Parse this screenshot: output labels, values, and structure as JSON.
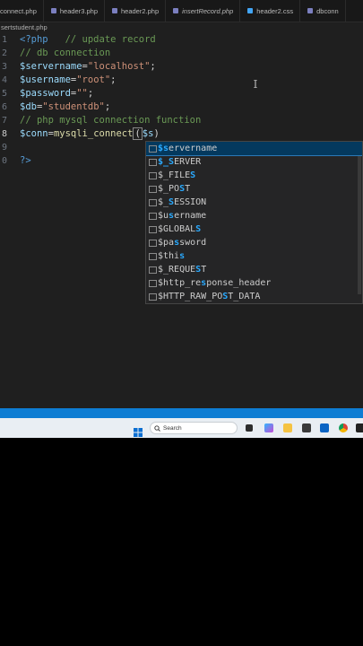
{
  "tabs": [
    {
      "label": "connect.php",
      "color": "#7b7fbf",
      "italic": false
    },
    {
      "label": "header3.php",
      "color": "#7b7fbf",
      "italic": false
    },
    {
      "label": "header2.php",
      "color": "#7b7fbf",
      "italic": false
    },
    {
      "label": "insertRecord.php",
      "color": "#7b7fbf",
      "italic": true
    },
    {
      "label": "header2.css",
      "color": "#42a5f5",
      "italic": false
    },
    {
      "label": "dbconn",
      "color": "#7b7fbf",
      "italic": false
    }
  ],
  "breadcrumb": "sertstudent.php",
  "lines": [
    {
      "n": "1",
      "parts": [
        {
          "t": "<?php",
          "c": "c-tag"
        },
        {
          "t": "   // update record",
          "c": "c-com"
        }
      ]
    },
    {
      "n": "2",
      "parts": [
        {
          "t": "// db connection",
          "c": "c-com"
        }
      ]
    },
    {
      "n": "3",
      "parts": [
        {
          "t": "$servername",
          "c": "c-var"
        },
        {
          "t": "=",
          "c": "c-pun"
        },
        {
          "t": "\"localhost\"",
          "c": "c-str"
        },
        {
          "t": ";",
          "c": "c-pun"
        }
      ]
    },
    {
      "n": "4",
      "parts": [
        {
          "t": "$username",
          "c": "c-var"
        },
        {
          "t": "=",
          "c": "c-pun"
        },
        {
          "t": "\"root\"",
          "c": "c-str"
        },
        {
          "t": ";",
          "c": "c-pun"
        }
      ]
    },
    {
      "n": "5",
      "parts": [
        {
          "t": "$password",
          "c": "c-var"
        },
        {
          "t": "=",
          "c": "c-pun"
        },
        {
          "t": "\"\"",
          "c": "c-str"
        },
        {
          "t": ";",
          "c": "c-pun"
        }
      ]
    },
    {
      "n": "6",
      "parts": [
        {
          "t": "$db",
          "c": "c-var"
        },
        {
          "t": "=",
          "c": "c-pun"
        },
        {
          "t": "\"studentdb\"",
          "c": "c-str"
        },
        {
          "t": ";",
          "c": "c-pun"
        }
      ]
    },
    {
      "n": "7",
      "parts": [
        {
          "t": "// php mysql connection function",
          "c": "c-com"
        }
      ]
    },
    {
      "n": "8",
      "parts": [
        {
          "t": "$conn",
          "c": "c-var"
        },
        {
          "t": "=",
          "c": "c-pun"
        },
        {
          "t": "mysqli_connect",
          "c": "c-fn"
        },
        {
          "t": "(",
          "c": "c-pun cursor-box"
        },
        {
          "t": "$s",
          "c": "c-var"
        },
        {
          "t": ")",
          "c": "c-pun"
        }
      ],
      "active": true
    },
    {
      "n": "9",
      "parts": []
    },
    {
      "n": "0",
      "parts": [
        {
          "t": "?>",
          "c": "c-tag"
        }
      ]
    }
  ],
  "suggestions": [
    {
      "pre": "",
      "hl": "$s",
      "post": "ervername",
      "selected": true
    },
    {
      "pre": "",
      "hl": "$_S",
      "post": "ERVER"
    },
    {
      "pre": "$_FILE",
      "hl": "S",
      "post": ""
    },
    {
      "pre": "$_PO",
      "hl": "S",
      "post": "T"
    },
    {
      "pre": "$_",
      "hl": "S",
      "post": "ESSION"
    },
    {
      "pre": "$u",
      "hl": "s",
      "post": "ername"
    },
    {
      "pre": "$GLOBAL",
      "hl": "S",
      "post": ""
    },
    {
      "pre": "$pa",
      "hl": "s",
      "post": "sword"
    },
    {
      "pre": "$thi",
      "hl": "s",
      "post": ""
    },
    {
      "pre": "$_REQUE",
      "hl": "S",
      "post": "T"
    },
    {
      "pre": "$http_re",
      "hl": "s",
      "post": "ponse_header"
    },
    {
      "pre": "$HTTP_RAW_PO",
      "hl": "S",
      "post": "T_DATA"
    }
  ],
  "taskbar": {
    "search_label": "Search"
  }
}
